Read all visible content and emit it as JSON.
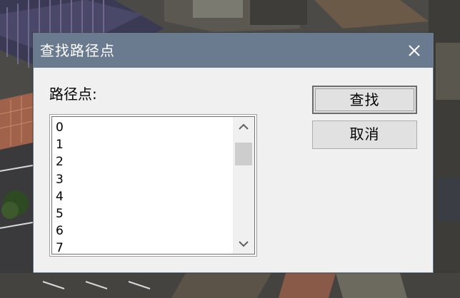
{
  "dialog": {
    "title": "查找路径点",
    "label": "路径点:",
    "list_items": [
      "0",
      "1",
      "2",
      "3",
      "4",
      "5",
      "6",
      "7"
    ],
    "find_label": "查找",
    "cancel_label": "取消"
  },
  "colors": {
    "titlebar": "#6a7a8f",
    "dialog_bg": "#f0f0f0",
    "scroll_thumb": "#cdcdcd"
  },
  "icons": {
    "close": "close-icon",
    "scroll_up": "chevron-up-icon",
    "scroll_down": "chevron-down-icon"
  }
}
